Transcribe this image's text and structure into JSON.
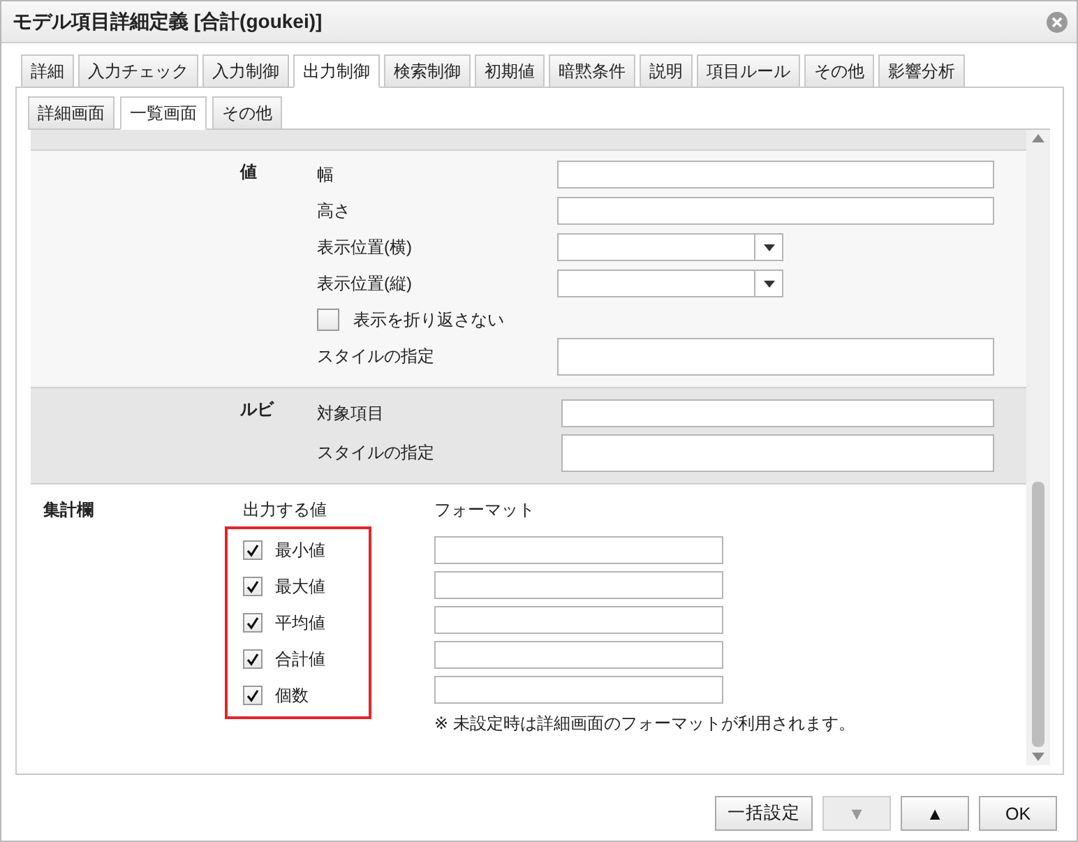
{
  "window": {
    "title": "モデル項目詳細定義 [合計(goukei)]"
  },
  "tabs": [
    {
      "label": "詳細",
      "selected": false
    },
    {
      "label": "入力チェック",
      "selected": false
    },
    {
      "label": "入力制御",
      "selected": false
    },
    {
      "label": "出力制御",
      "selected": true
    },
    {
      "label": "検索制御",
      "selected": false
    },
    {
      "label": "初期値",
      "selected": false
    },
    {
      "label": "暗黙条件",
      "selected": false
    },
    {
      "label": "説明",
      "selected": false
    },
    {
      "label": "項目ルール",
      "selected": false
    },
    {
      "label": "その他",
      "selected": false
    },
    {
      "label": "影響分析",
      "selected": false
    }
  ],
  "subtabs": [
    {
      "label": "詳細画面",
      "selected": false
    },
    {
      "label": "一覧画面",
      "selected": true
    },
    {
      "label": "その他",
      "selected": false
    }
  ],
  "sections": [
    {
      "label": "値",
      "shaded": false,
      "rows": [
        {
          "kind": "text",
          "label": "幅"
        },
        {
          "kind": "text",
          "label": "高さ"
        },
        {
          "kind": "select",
          "label": "表示位置(横)"
        },
        {
          "kind": "select",
          "label": "表示位置(縦)"
        },
        {
          "kind": "checkbox",
          "label": "表示を折り返さない",
          "checked": false
        },
        {
          "kind": "textarea",
          "label": "スタイルの指定"
        }
      ]
    },
    {
      "label": "ルビ",
      "shaded": true,
      "rows": [
        {
          "kind": "text",
          "label": "対象項目"
        },
        {
          "kind": "textarea",
          "label": "スタイルの指定"
        }
      ]
    }
  ],
  "summary": {
    "label": "集計欄",
    "value_header": "出力する値",
    "format_header": "フォーマット",
    "highlighted": true,
    "items": [
      {
        "label": "最小値",
        "checked": true
      },
      {
        "label": "最大値",
        "checked": true
      },
      {
        "label": "平均値",
        "checked": true
      },
      {
        "label": "合計値",
        "checked": true
      },
      {
        "label": "個数",
        "checked": true
      }
    ],
    "note": "※ 未設定時は詳細画面のフォーマットが利用されます。"
  },
  "buttons": [
    {
      "label": "一括設定",
      "disabled": false
    },
    {
      "label": "▼",
      "disabled": true
    },
    {
      "label": "▲",
      "disabled": false
    },
    {
      "label": "OK",
      "disabled": false
    }
  ]
}
